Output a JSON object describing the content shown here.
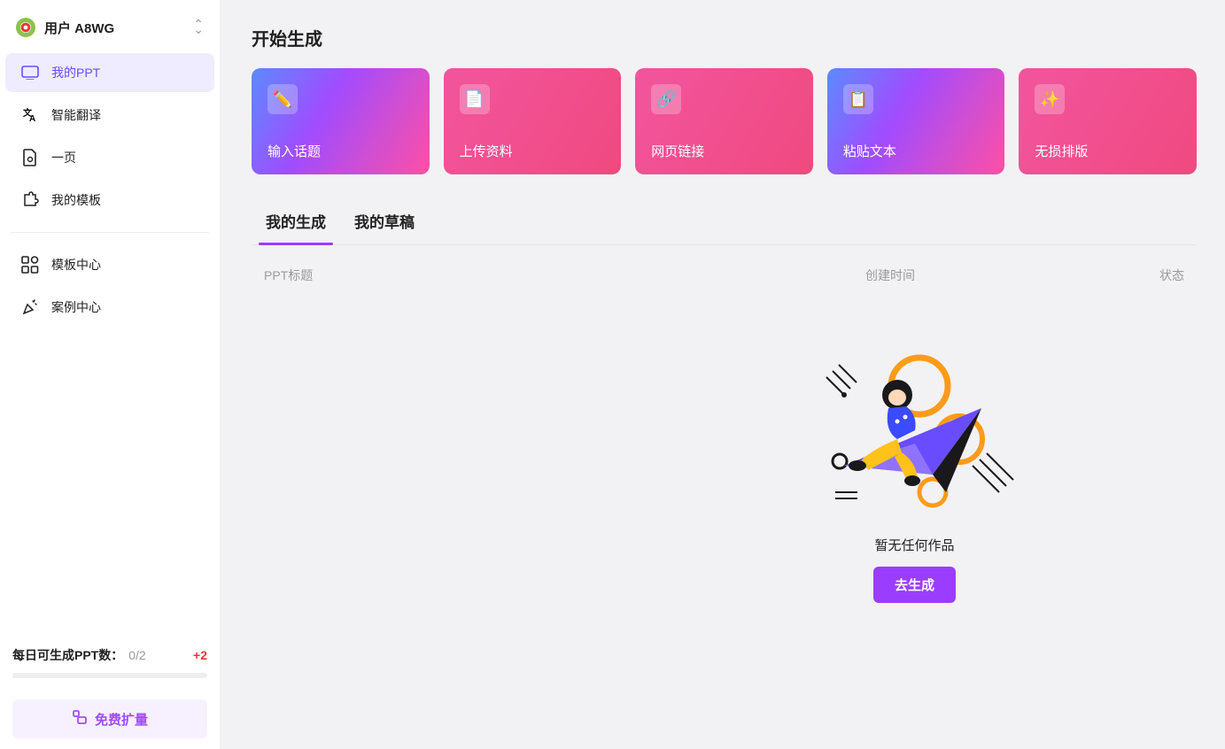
{
  "user": {
    "name": "用户 A8WG"
  },
  "sidebar": {
    "items": [
      {
        "label": "我的PPT"
      },
      {
        "label": "智能翻译"
      },
      {
        "label": "一页"
      },
      {
        "label": "我的模板"
      },
      {
        "label": "模板中心"
      },
      {
        "label": "案例中心"
      }
    ]
  },
  "quota": {
    "label": "每日可生成PPT数：",
    "value": "0/2",
    "plus": "+2"
  },
  "expand_button": "免费扩量",
  "section_title": "开始生成",
  "cards": [
    {
      "label": "输入话题",
      "icon": "✏️"
    },
    {
      "label": "上传资料",
      "icon": "📄"
    },
    {
      "label": "网页链接",
      "icon": "🔗"
    },
    {
      "label": "粘贴文本",
      "icon": "📋"
    },
    {
      "label": "无损排版",
      "icon": "✨"
    }
  ],
  "tabs": [
    {
      "label": "我的生成"
    },
    {
      "label": "我的草稿"
    }
  ],
  "table": {
    "col_title": "PPT标题",
    "col_time": "创建时间",
    "col_status": "状态"
  },
  "empty": {
    "text": "暂无任何作品",
    "button": "去生成"
  }
}
